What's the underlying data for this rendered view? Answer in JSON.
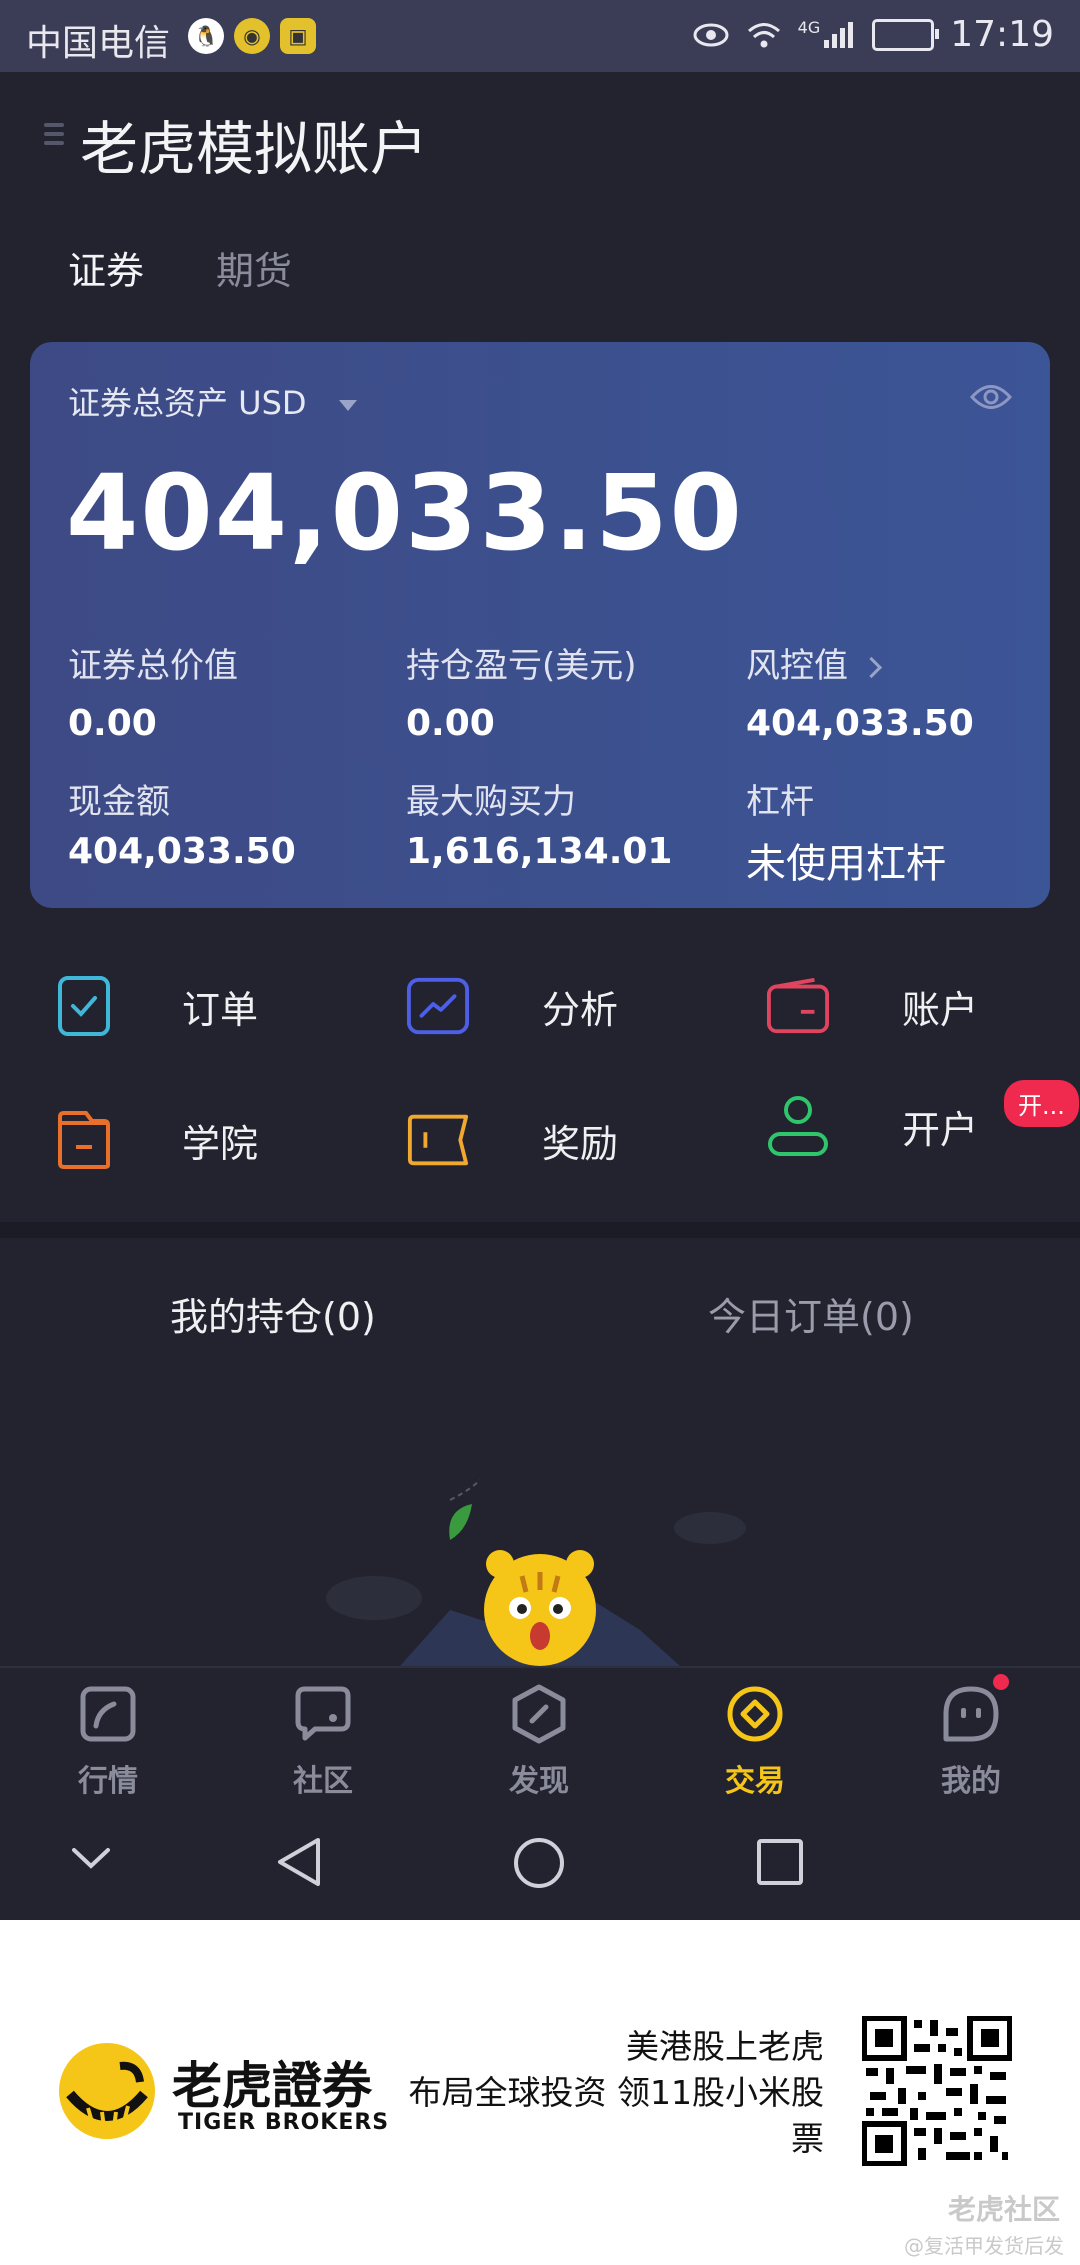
{
  "status_bar": {
    "carrier": "中国电信",
    "network": "4G",
    "time": "17:19",
    "icons": [
      "qq-icon",
      "coin-icon",
      "app-badge-icon"
    ]
  },
  "header": {
    "title": "老虎模拟账户",
    "tabs": [
      {
        "label": "证券",
        "active": true
      },
      {
        "label": "期货",
        "active": false
      }
    ]
  },
  "asset_card": {
    "label": "证券总资产 USD",
    "total": "404,033.50",
    "metrics": [
      {
        "label": "证券总价值",
        "value": "0.00"
      },
      {
        "label": "持仓盈亏(美元)",
        "value": "0.00"
      },
      {
        "label": "风控值",
        "value": "404,033.50"
      },
      {
        "label": "现金额",
        "value": "404,033.50"
      },
      {
        "label": "最大购买力",
        "value": "1,616,134.01"
      },
      {
        "label": "杠杆",
        "value": "未使用杠杆"
      }
    ]
  },
  "features": [
    {
      "label": "订单",
      "icon": "order-check-icon",
      "color": "#3fb7d8"
    },
    {
      "label": "分析",
      "icon": "analysis-chart-icon",
      "color": "#4d5fe6"
    },
    {
      "label": "账户",
      "icon": "wallet-icon",
      "color": "#e0445e"
    },
    {
      "label": "学院",
      "icon": "folder-icon",
      "color": "#e8702a"
    },
    {
      "label": "奖励",
      "icon": "ticket-icon",
      "color": "#f0a830"
    },
    {
      "label": "开户",
      "icon": "user-icon",
      "color": "#2ec56b"
    }
  ],
  "open_account_badge": "开...",
  "position_tabs": {
    "holdings": "我的持仓(0)",
    "orders": "今日订单(0)"
  },
  "bottom_nav": [
    {
      "label": "行情",
      "icon": "market-icon",
      "active": false
    },
    {
      "label": "社区",
      "icon": "community-icon",
      "active": false
    },
    {
      "label": "发现",
      "icon": "discover-icon",
      "active": false
    },
    {
      "label": "交易",
      "icon": "trade-icon",
      "active": true
    },
    {
      "label": "我的",
      "icon": "profile-icon",
      "active": false
    }
  ],
  "banner": {
    "brand_cn": "老虎證券",
    "brand_en": "TIGER BROKERS",
    "promo_line1": "美港股上老虎",
    "promo_line2": "布局全球投资 领11股小米股",
    "promo_line3": "票",
    "watermark": "老虎社区",
    "watermark_sub": "@复活甲发货后发"
  },
  "colors": {
    "accent_active": "#f5c518",
    "background": "#22232f",
    "card_start": "#3d4a85",
    "card_end": "#3c5596",
    "badge": "#f0294f"
  }
}
